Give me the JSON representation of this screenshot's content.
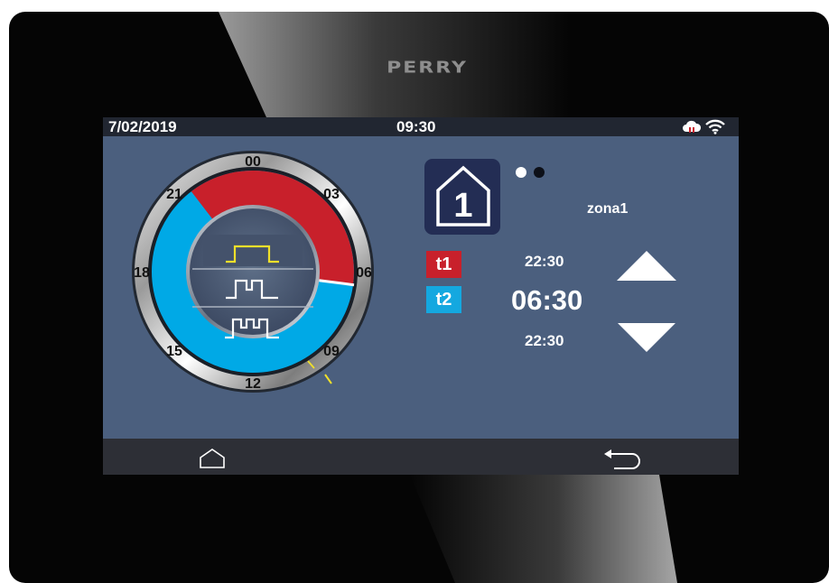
{
  "brand": "PERRY",
  "status_bar": {
    "date": "7/02/2019",
    "time": "09:30",
    "icons": [
      "cloud-alert-icon",
      "wifi-icon"
    ]
  },
  "dial": {
    "hour_labels": [
      "00",
      "03",
      "06",
      "09",
      "12",
      "15",
      "18",
      "21"
    ],
    "segments": [
      {
        "name": "t1",
        "from": "21:30",
        "to": "06:30",
        "color": "#c8202b"
      },
      {
        "name": "t2",
        "from": "06:30",
        "to": "21:30",
        "color": "#00a9e6"
      }
    ],
    "current_time_marker": "09:30",
    "program_icons": [
      "single-pulse-icon",
      "double-pulse-icon",
      "triple-pulse-icon"
    ],
    "selected_program": 0
  },
  "zone": {
    "number": "1",
    "label": "zona1",
    "page_dots": 2,
    "active_dot": 0
  },
  "bands": {
    "t1_label": "t1",
    "t2_label": "t2",
    "time_upper": "22:30",
    "time_main": "06:30",
    "time_lower": "22:30"
  },
  "colors": {
    "t1": "#c8202b",
    "t2": "#14a8e0",
    "screen_bg": "#4b5f7e",
    "status_bg": "#212631",
    "nav_bg": "#2d2f36",
    "highlight": "#f0e02a"
  },
  "nav": {
    "icons": [
      "home-icon",
      "back-icon"
    ]
  }
}
